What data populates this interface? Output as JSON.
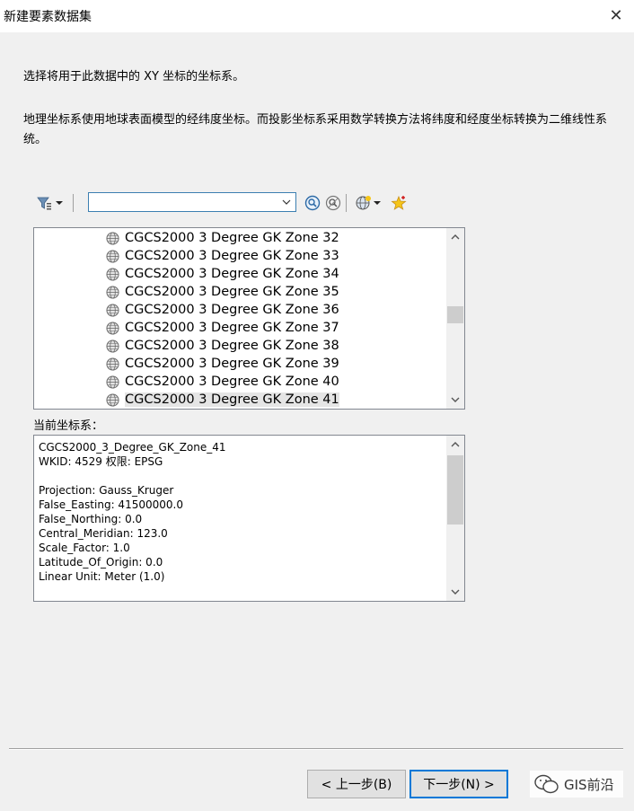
{
  "window": {
    "title": "新建要素数据集",
    "close_glyph": "✕"
  },
  "descriptions": {
    "line1": "选择将用于此数据中的 XY 坐标的坐标系。",
    "line2": "地理坐标系使用地球表面模型的经纬度坐标。而投影坐标系采用数学转换方法将纬度和经度坐标转换为二维线性系统。"
  },
  "toolbar": {
    "search_value": "",
    "icons": [
      "filter-icon",
      "dropdown-arrow-icon",
      "search-icon",
      "clear-search-icon",
      "globe-add-icon",
      "dropdown-arrow-icon",
      "favorite-add-icon"
    ]
  },
  "crs_list": {
    "items": [
      "CGCS2000 3 Degree GK Zone 32",
      "CGCS2000 3 Degree GK Zone 33",
      "CGCS2000 3 Degree GK Zone 34",
      "CGCS2000 3 Degree GK Zone 35",
      "CGCS2000 3 Degree GK Zone 36",
      "CGCS2000 3 Degree GK Zone 37",
      "CGCS2000 3 Degree GK Zone 38",
      "CGCS2000 3 Degree GK Zone 39",
      "CGCS2000 3 Degree GK Zone 40",
      "CGCS2000 3 Degree GK Zone 41"
    ],
    "selected_index": 9
  },
  "current": {
    "label": "当前坐标系：",
    "lines": [
      "CGCS2000_3_Degree_GK_Zone_41",
      "WKID: 4529 权限: EPSG",
      "",
      "Projection: Gauss_Kruger",
      "False_Easting: 41500000.0",
      "False_Northing: 0.0",
      "Central_Meridian: 123.0",
      "Scale_Factor: 1.0",
      "Latitude_Of_Origin: 0.0",
      "Linear Unit: Meter (1.0)"
    ]
  },
  "buttons": {
    "back": "< 上一步(B)",
    "next": "下一步(N) >"
  },
  "watermark": {
    "text": "GIS前沿"
  },
  "colors": {
    "accent": "#0078d7",
    "window_bg": "#f0f0f0"
  }
}
